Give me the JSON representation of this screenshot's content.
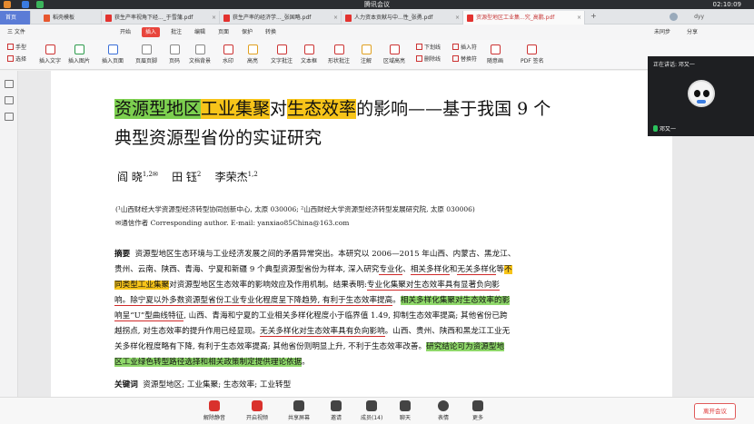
{
  "meeting": {
    "title": "腾讯会议",
    "timer": "02:10:09",
    "speaking_label": "正在讲话: 邓又一",
    "participant_name": "邓又一",
    "bottom": {
      "mute": "解除静音",
      "video": "开启视频",
      "share": "共享屏幕",
      "invite": "邀请",
      "members": "成员(14)",
      "chat": "聊天",
      "reactions": "表情",
      "more": "更多",
      "leave": "离开会议"
    }
  },
  "tabs": [
    {
      "label": "首页"
    },
    {
      "label": "稻壳模板"
    },
    {
      "label": "获生产率视角下经..._于雪蒲.pdf"
    },
    {
      "label": "获生产率的经济学..._张国略.pdf"
    },
    {
      "label": "人力资本贡献与中...性_张勇.pdf"
    },
    {
      "label": "资源型地区工业集...究_高鹏.pdf"
    }
  ],
  "user_label": "dyy",
  "menus": [
    "三 文件",
    "开始",
    "插入",
    "批注",
    "编辑",
    "页面",
    "保护",
    "转换"
  ],
  "menu_right": [
    "未同步",
    "分享"
  ],
  "tools": {
    "hand": "手型",
    "select": "选择",
    "insert_text": "插入文字",
    "insert_image": "插入图片",
    "insert_page": "插入页面",
    "header_footer": "页眉页脚",
    "page_number": "页码",
    "doc_background": "文档背景",
    "watermark": "水印",
    "highlight": "高亮",
    "text_annot": "文字批注",
    "textbox": "文本框",
    "shape_annot": "形状批注",
    "annotation": "注解",
    "area_highlight": "区域高亮",
    "underline": "下划线",
    "strikethrough": "删除线",
    "insert": "插入符",
    "replace": "替换符",
    "stamp": "随意画",
    "pdf_sign": "PDF 签名"
  },
  "paper": {
    "title_line1": [
      "资源型地区",
      "工业集聚",
      "对",
      "生态效率",
      "的影响——基于我国 9 个"
    ],
    "title_line2": "典型资源型省份的实证研究",
    "authors": [
      {
        "name": "阎  晓",
        "sup": "1,2✉"
      },
      {
        "name": "田  钰",
        "sup": "2"
      },
      {
        "name": "李荣杰",
        "sup": "1,2"
      }
    ],
    "affiliation": "(¹山西财经大学资源型经济转型协同创新中心, 太原 030006; ²山西财经大学资源型经济转型发展研究院, 太原 030006)",
    "corresponding": "✉通信作者    Corresponding author. E-mail: yanxiao85China@163.com",
    "abstract_label": "摘要",
    "abstract_lines": [
      "资源型地区生态环境与工业经济发展之间的矛盾异常突出。本研究以 2006—2015 年山西、内蒙古、黑龙江、",
      "贵州、云南、陕西、青海、宁夏和新疆 9 个典型资源型省份为样本, 深入研究",
      "专业化",
      "、",
      "相关多样化",
      "和",
      "无关多样化",
      "等",
      "不",
      "同类型工业集聚",
      "对资源型地区生态效率的影响效应及作用机制。结果表明:",
      "专业化集聚对生态效率具有显著负向影",
      "响。除宁夏以外多数资源型省份工业专业化程度呈下降趋势, 有利于生态效率提高",
      "。",
      "相关多样化集聚对生态效率的影",
      "响呈“U”型曲线特征",
      ", 山西、青海和宁夏的工业相关多样化程度小于临界值 1.49, 抑制生态效率提高; 其他省份已跨",
      "越拐点, 对生态效率的提升作用已经显现。",
      "无关多样化对生态效率具有负向影响",
      "。山西、贵州、陕西和黑龙江工业无",
      "关多样化程度略有下降, 有利于生态效率提高; 其他省份则明显上升, 不利于生态效率改善",
      "。",
      "研究结论可为资源型地",
      "区工业绿色转型路径选择和相关政策制定提供理论依据",
      "。"
    ],
    "keywords_label": "关键词",
    "keywords": "资源型地区; 工业集聚; 生态效率; 工业转型"
  }
}
